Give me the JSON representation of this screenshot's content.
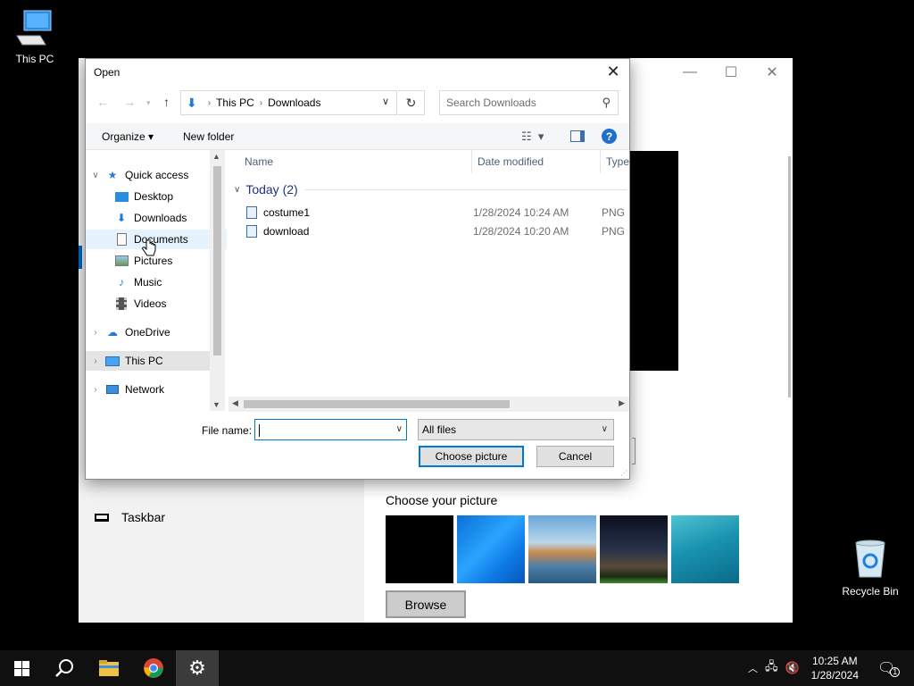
{
  "desktop": {
    "this_pc": "This PC",
    "recycle_bin": "Recycle Bin"
  },
  "settings": {
    "taskbar_label": "Taskbar",
    "choose_picture_title": "Choose your picture",
    "browse_label": "Browse",
    "controls": {
      "minimize": "—",
      "maximize": "☐",
      "close": "✕"
    }
  },
  "dialog": {
    "title": "Open",
    "close": "✕",
    "address": {
      "segments": [
        "This PC",
        "Downloads"
      ]
    },
    "search_placeholder": "Search Downloads",
    "toolbar": {
      "organize": "Organize ▾",
      "new_folder": "New folder",
      "help": "?"
    },
    "nav": {
      "quick_access": "Quick access",
      "desktop": "Desktop",
      "downloads": "Downloads",
      "documents": "Documents",
      "pictures": "Pictures",
      "music": "Music",
      "videos": "Videos",
      "onedrive": "OneDrive",
      "this_pc": "This PC",
      "network": "Network"
    },
    "columns": {
      "name": "Name",
      "date": "Date modified",
      "type": "Type"
    },
    "group": "Today (2)",
    "files": [
      {
        "name": "costume1",
        "date": "1/28/2024 10:24 AM",
        "type": "PNG"
      },
      {
        "name": "download",
        "date": "1/28/2024 10:20 AM",
        "type": "PNG"
      }
    ],
    "file_name_label": "File name:",
    "file_name_value": "",
    "filter": "All files",
    "choose_button": "Choose picture",
    "cancel_button": "Cancel"
  },
  "taskbar": {
    "time": "10:25 AM",
    "date": "1/28/2024",
    "notification_count": "1"
  }
}
